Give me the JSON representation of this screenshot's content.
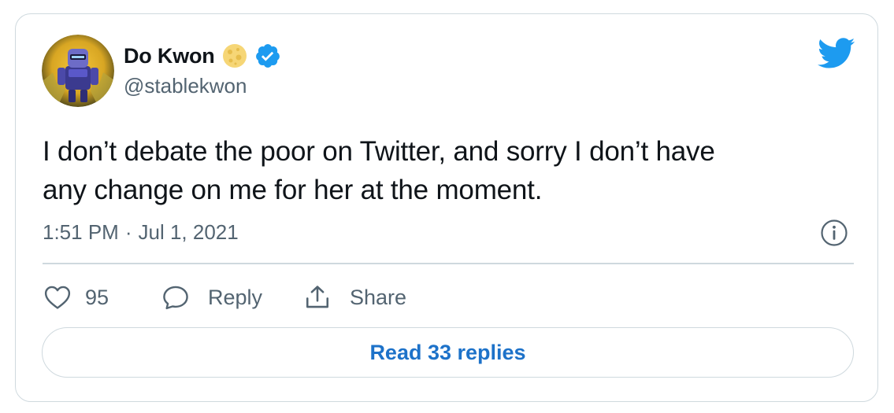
{
  "author": {
    "display_name": "Do Kwon",
    "handle": "@stablekwon",
    "verified": true,
    "emoji": "moon-emoji"
  },
  "tweet": {
    "text_line1": "I don’t debate the poor on Twitter, and sorry I don’t have",
    "text_line2": "any change on me for her at the moment.",
    "time": "1:51 PM",
    "separator": "·",
    "date": "Jul 1, 2021"
  },
  "actions": {
    "like_count": "95",
    "reply_label": "Reply",
    "share_label": "Share"
  },
  "read_replies_label": "Read 33 replies",
  "icons": {
    "brand": "twitter-bird-icon",
    "info": "info-icon",
    "like": "heart-icon",
    "reply": "speech-bubble-icon",
    "share": "share-icon",
    "verified": "verified-badge-icon"
  },
  "colors": {
    "twitter_blue": "#1d9bf0",
    "link_blue": "#1d72c9",
    "text_primary": "#0f1419",
    "text_secondary": "#536471",
    "border": "#cfd9de"
  }
}
